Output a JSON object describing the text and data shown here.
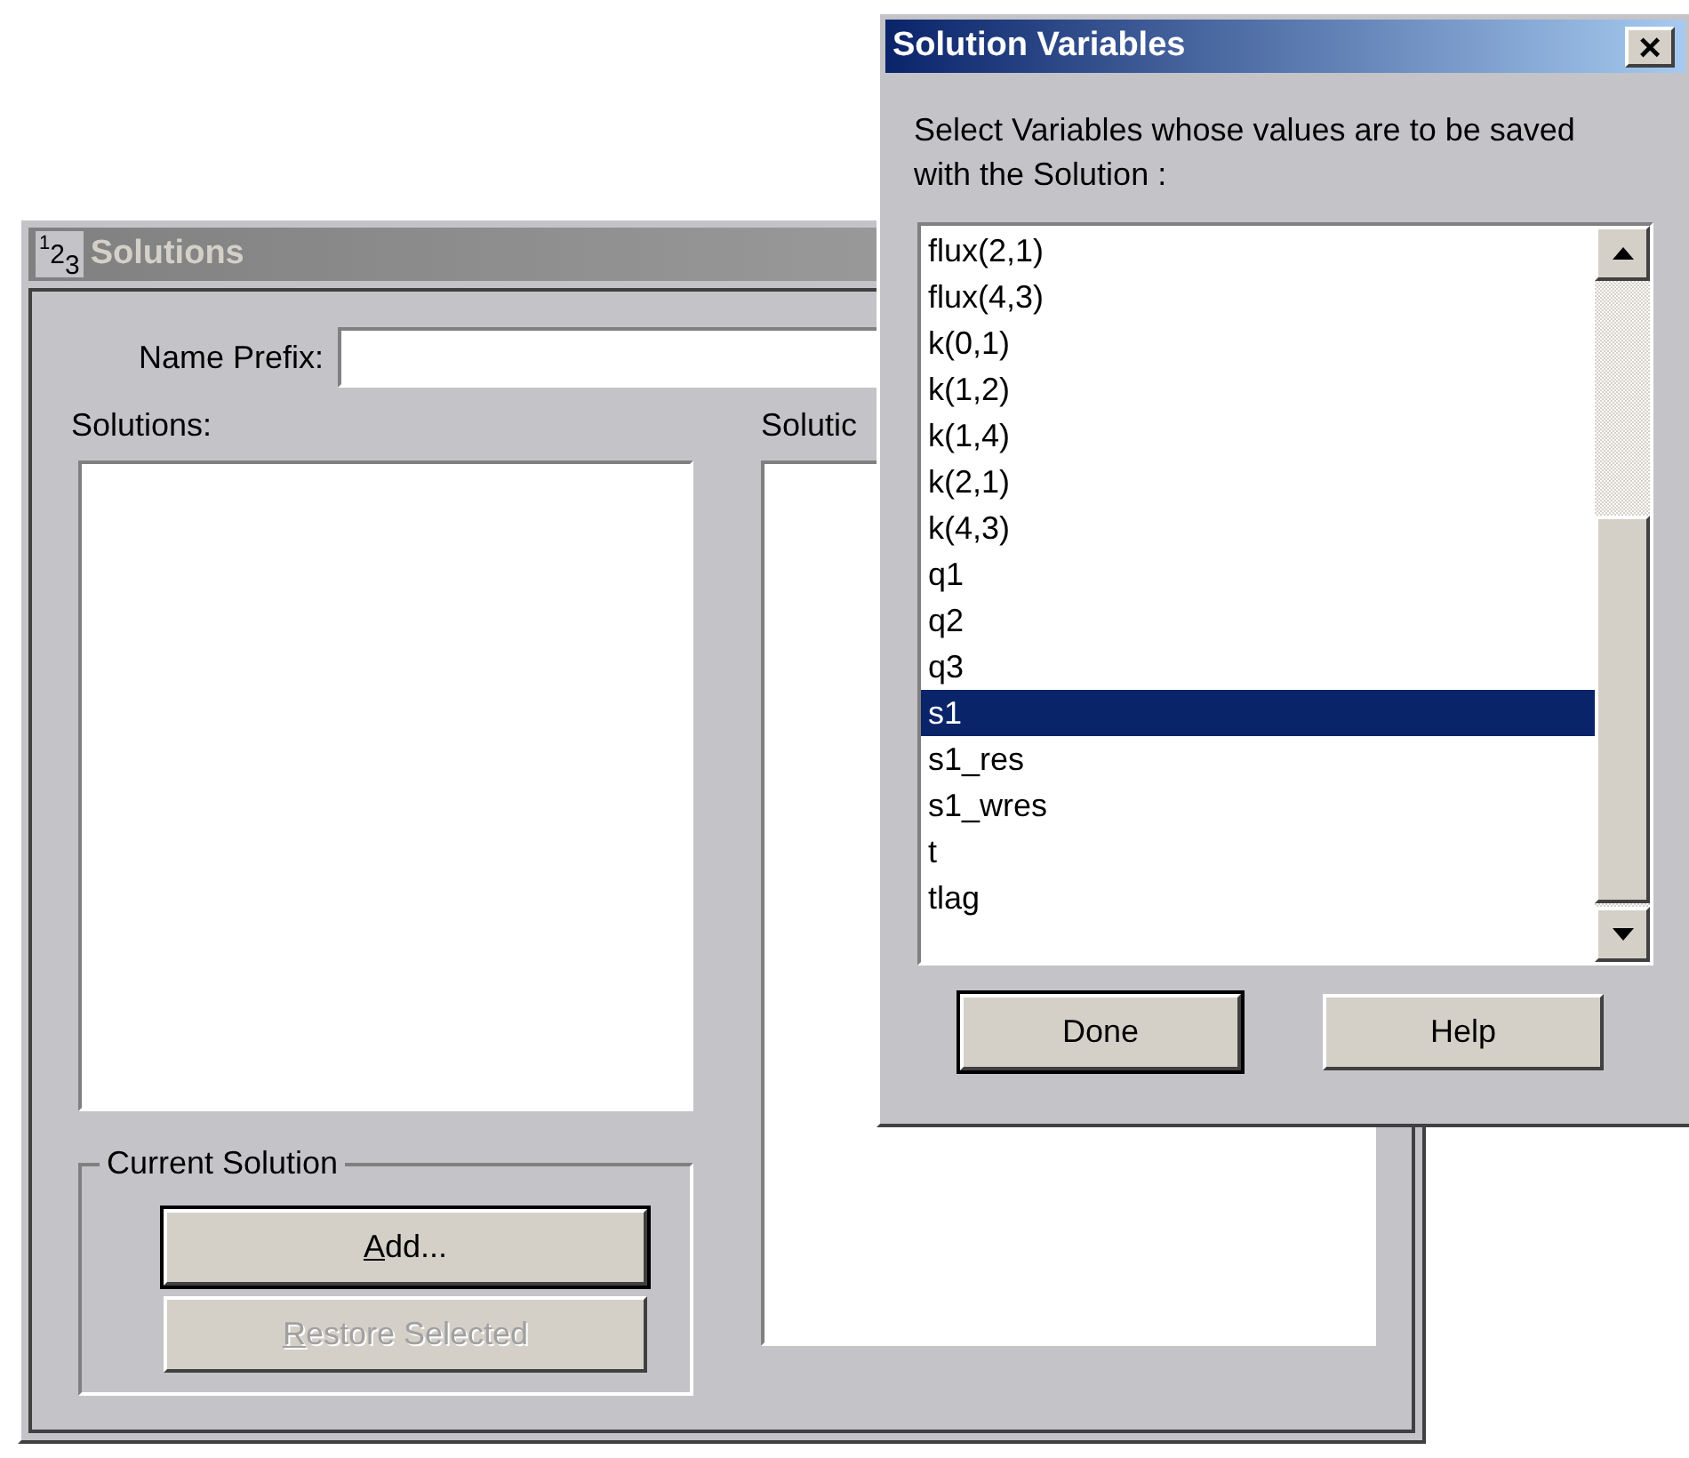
{
  "solutions_window": {
    "title": "Solutions",
    "title_icon": [
      "1",
      "2",
      "3"
    ],
    "active": false,
    "name_prefix": {
      "label": "Name Prefix:"
    },
    "solutions_label": "Solutions:",
    "column_2_label": "Solutic",
    "group": {
      "label": "Current Solution",
      "buttons": [
        {
          "label": "Add...",
          "default": true,
          "disabled": false
        },
        {
          "label": "Restore Selected",
          "default": false,
          "disabled": true
        }
      ]
    }
  },
  "variables_dialog": {
    "title": "Solution Variables",
    "active": true,
    "close": "×",
    "prompt": "Select Variables whose values are to be saved with the Solution :",
    "items": [
      {
        "label": "flux(2,1)",
        "selected": false
      },
      {
        "label": "flux(4,3)",
        "selected": false
      },
      {
        "label": "k(0,1)",
        "selected": false
      },
      {
        "label": "k(1,2)",
        "selected": false
      },
      {
        "label": "k(1,4)",
        "selected": false
      },
      {
        "label": "k(2,1)",
        "selected": false
      },
      {
        "label": "k(4,3)",
        "selected": false
      },
      {
        "label": "q1",
        "selected": false
      },
      {
        "label": "q2",
        "selected": false
      },
      {
        "label": "q3",
        "selected": false
      },
      {
        "label": "s1",
        "selected": true
      },
      {
        "label": "s1_res",
        "selected": false
      },
      {
        "label": "s1_wres",
        "selected": false
      },
      {
        "label": "t",
        "selected": false
      },
      {
        "label": "tlag",
        "selected": false
      }
    ],
    "buttons": [
      {
        "label": "Done",
        "default": true
      },
      {
        "label": "Help",
        "default": false
      }
    ]
  }
}
